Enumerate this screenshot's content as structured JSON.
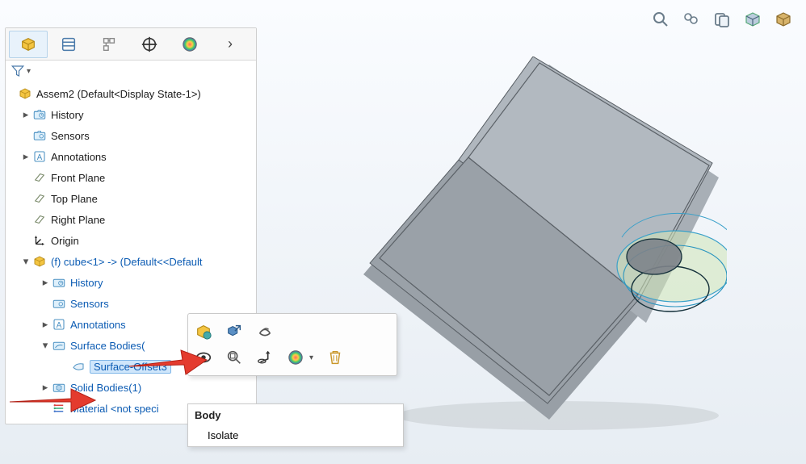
{
  "assembly_root": "Assem2  (Default<Display State-1>)",
  "tree": {
    "history": "History",
    "sensors": "Sensors",
    "annotations": "Annotations",
    "front_plane": "Front Plane",
    "top_plane": "Top Plane",
    "right_plane": "Right Plane",
    "origin": "Origin",
    "component": "(f) cube<1> -> (Default<<Default",
    "sub_history": "History",
    "sub_sensors": "Sensors",
    "sub_annotations": "Annotations",
    "surface_bodies": "Surface Bodies(",
    "surface_offset": "Surface-Offset3",
    "solid_bodies": "Solid Bodies(1)",
    "material": "Material <not speci"
  },
  "context_menu": {
    "header": "Body",
    "isolate": "Isolate"
  }
}
